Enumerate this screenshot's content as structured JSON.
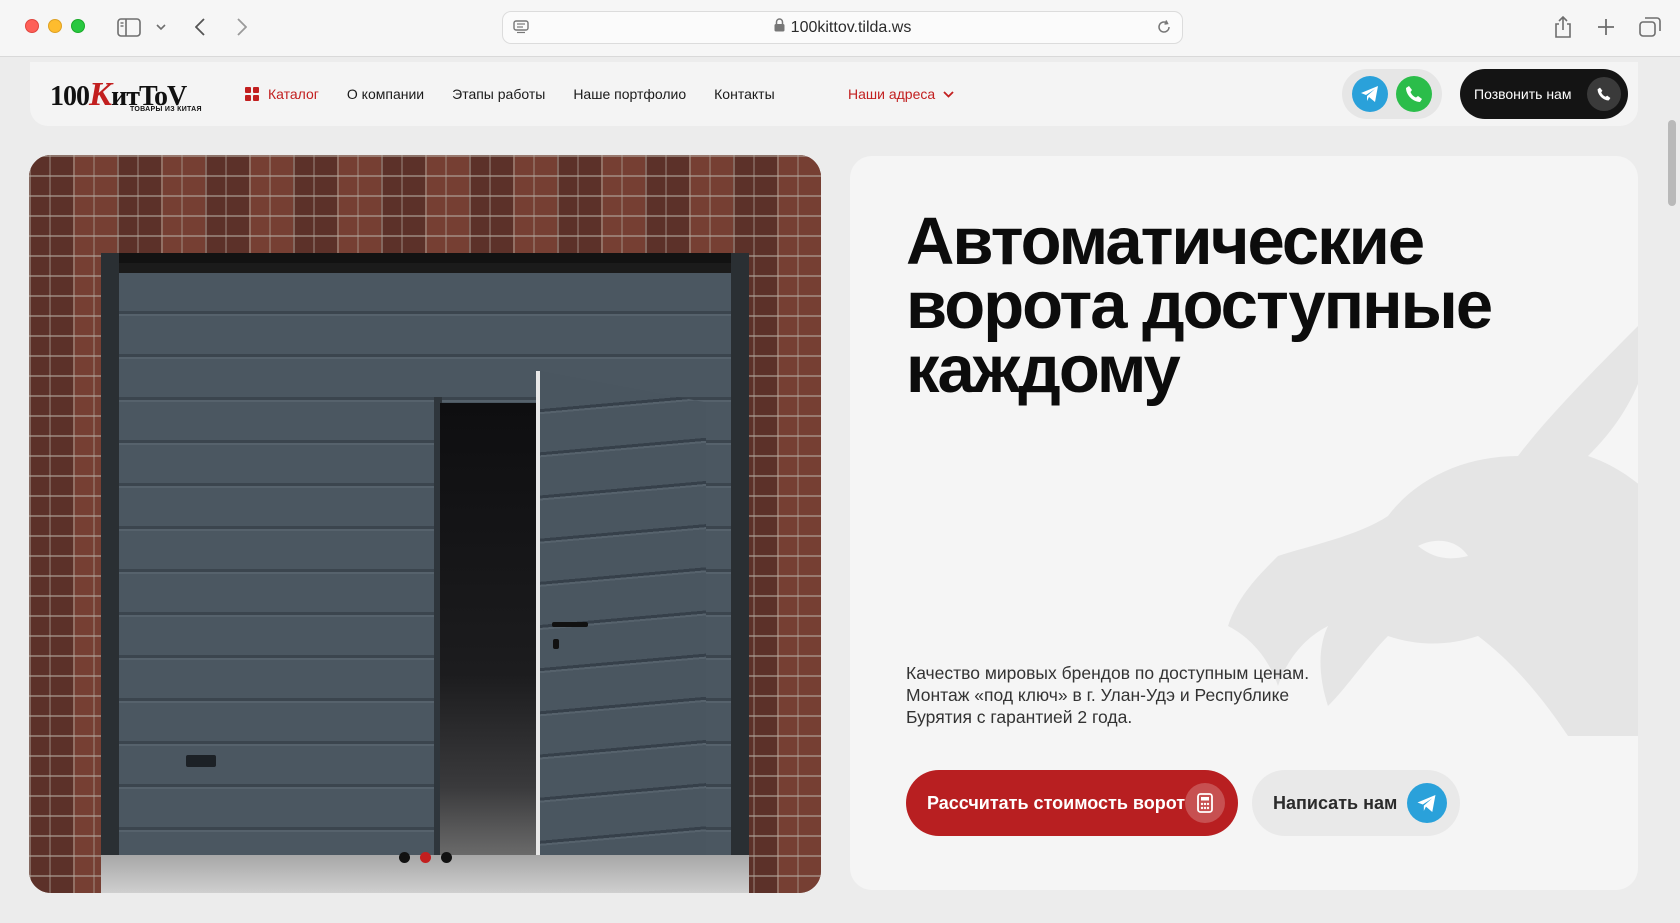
{
  "browser": {
    "url": "100kittov.tilda.ws",
    "colors": {
      "close": "#fe5f57",
      "minimize": "#febc2e",
      "maximize": "#28c840"
    },
    "icons": [
      "sidebar-icon",
      "chevron-down-icon",
      "back-icon",
      "forward-icon",
      "reader-icon",
      "lock-icon",
      "reload-icon",
      "share-icon",
      "new-tab-icon",
      "tabs-overview-icon"
    ]
  },
  "header": {
    "logo": {
      "main_prefix": "100",
      "main_red": "К",
      "main_suffix": "итToV",
      "sub": "ТОВАРЫ ИЗ КИТАЯ"
    },
    "menu": [
      {
        "label": "Каталог",
        "active": true
      },
      {
        "label": "О компании"
      },
      {
        "label": "Этапы работы"
      },
      {
        "label": "Наше портфолио"
      },
      {
        "label": "Контакты"
      }
    ],
    "addresses_label": "Наши адреса",
    "call_label": "Позвонить нам",
    "colors": {
      "accent": "#c21f1f",
      "telegram": "#2aa1da",
      "whatsapp": "#2bbd4a",
      "dark": "#141414"
    }
  },
  "slider": {
    "slide_count": 3,
    "active_index": 1
  },
  "hero": {
    "title_line1": "Автоматические",
    "title_line2": "ворота доступные",
    "title_line3": "каждому",
    "desc_line1": "Качество мировых брендов по доступным ценам.",
    "desc_line2": "Монтаж «под ключ» в г. Улан-Удэ и Республике",
    "desc_line3": "Бурятия с гарантией 2 года.",
    "primary_button": "Рассчитать стоимость ворот",
    "secondary_button": "Написать нам",
    "colors": {
      "primary": "#b81f21",
      "secondary_bg": "#e9e9e9"
    }
  }
}
